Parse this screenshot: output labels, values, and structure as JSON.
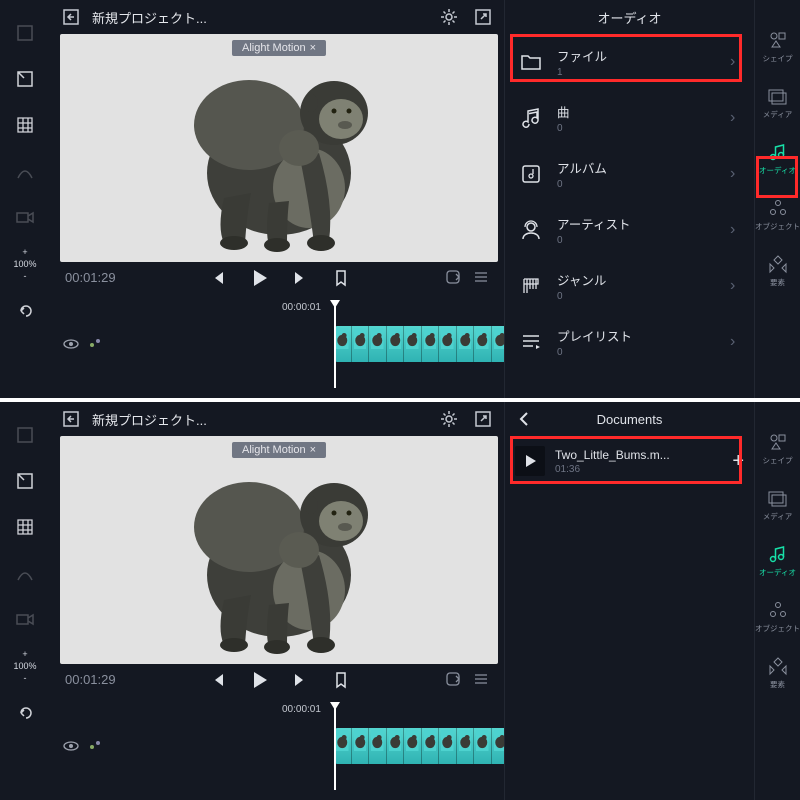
{
  "project_name": "新規プロジェクト...",
  "watermark": "Alight Motion",
  "timecode": "00:01:29",
  "timeline_time": "00:00:01",
  "zoom": {
    "plus": "+",
    "label": "100%",
    "minus": "-"
  },
  "audio_panel_title": "オーディオ",
  "audio_items": [
    {
      "label": "ファイル",
      "count": "1"
    },
    {
      "label": "曲",
      "count": "0"
    },
    {
      "label": "アルバム",
      "count": "0"
    },
    {
      "label": "アーティスト",
      "count": "0"
    },
    {
      "label": "ジャンル",
      "count": "0"
    },
    {
      "label": "プレイリスト",
      "count": "0"
    }
  ],
  "right_tabs": [
    {
      "label": "シェイプ"
    },
    {
      "label": "メディア"
    },
    {
      "label": "オーディオ"
    },
    {
      "label": "オブジェクト"
    },
    {
      "label": "要素"
    }
  ],
  "documents": {
    "title": "Documents",
    "file_name": "Two_Little_Bums.m...",
    "file_duration": "01:36"
  }
}
